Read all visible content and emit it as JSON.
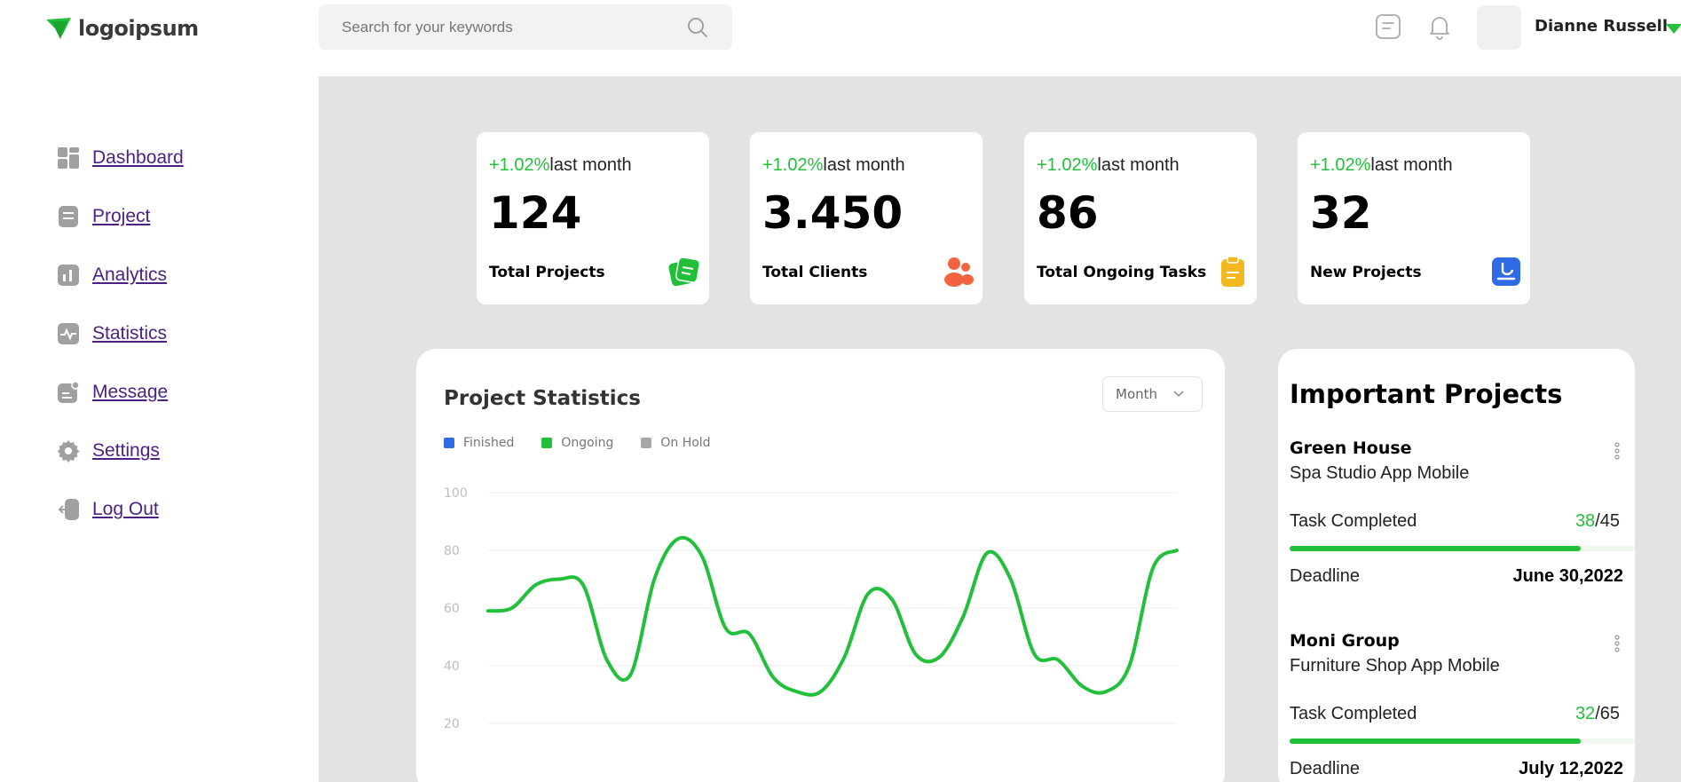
{
  "header": {
    "logo_text": "logoipsum",
    "search_placeholder": "Search for your keywords",
    "user_name": "Dianne Russell"
  },
  "sidebar": {
    "items": [
      {
        "label": "Dashboard",
        "icon": "grid-icon"
      },
      {
        "label": "Project",
        "icon": "document-icon"
      },
      {
        "label": "Analytics",
        "icon": "bar-chart-icon"
      },
      {
        "label": "Statistics",
        "icon": "pulse-icon"
      },
      {
        "label": "Message",
        "icon": "message-icon"
      },
      {
        "label": "Settings",
        "icon": "gear-icon"
      },
      {
        "label": "Log Out",
        "icon": "logout-icon"
      }
    ]
  },
  "cards": [
    {
      "delta": "+1.02%",
      "delta_suffix": "last month",
      "value": "124",
      "label": "Total Projects",
      "icon": "folder-icon",
      "icon_color": "#22c03a"
    },
    {
      "delta": "+1.02%",
      "delta_suffix": "last month",
      "value": "3.450",
      "label": "Total Clients",
      "icon": "users-icon",
      "icon_color": "#f2643f"
    },
    {
      "delta": "+1.02%",
      "delta_suffix": "last month",
      "value": "86",
      "label": "Total Ongoing Tasks",
      "icon": "clipboard-icon",
      "icon_color": "#f2b81d"
    },
    {
      "delta": "+1.02%",
      "delta_suffix": "last month",
      "value": "32",
      "label": "New Projects",
      "icon": "report-icon",
      "icon_color": "#2f6be6"
    }
  ],
  "project_statistics": {
    "title": "Project Statistics",
    "period_select": "Month",
    "legend": [
      {
        "name": "Finished",
        "color": "#2f6be6"
      },
      {
        "name": "Ongoing",
        "color": "#22c03a"
      },
      {
        "name": "On Hold",
        "color": "#a7a7a7"
      }
    ]
  },
  "chart_data": {
    "type": "line",
    "y_ticks": [
      20,
      40,
      60,
      80,
      100
    ],
    "ylim": [
      20,
      100
    ],
    "series": [
      {
        "name": "Ongoing",
        "color": "#22c03a",
        "values": [
          59,
          60,
          68,
          70,
          68,
          42,
          37,
          70,
          84,
          78,
          53,
          51,
          36,
          31,
          31,
          43,
          65,
          63,
          44,
          43,
          57,
          79,
          70,
          44,
          42,
          33,
          31,
          40,
          74,
          80
        ]
      }
    ]
  },
  "important_projects": {
    "title": "Important Projects",
    "task_label": "Task Completed",
    "deadline_label": "Deadline",
    "projects": [
      {
        "name": "Green House",
        "subtitle": "Spa Studio App Mobile",
        "done": "38",
        "total": "/45",
        "progress": 0.844,
        "deadline": "June 30,2022"
      },
      {
        "name": "Moni Group",
        "subtitle": "Furniture Shop App Mobile",
        "done": "32",
        "total": "/65",
        "progress": 0.844,
        "deadline": "July 12,2022"
      }
    ]
  }
}
